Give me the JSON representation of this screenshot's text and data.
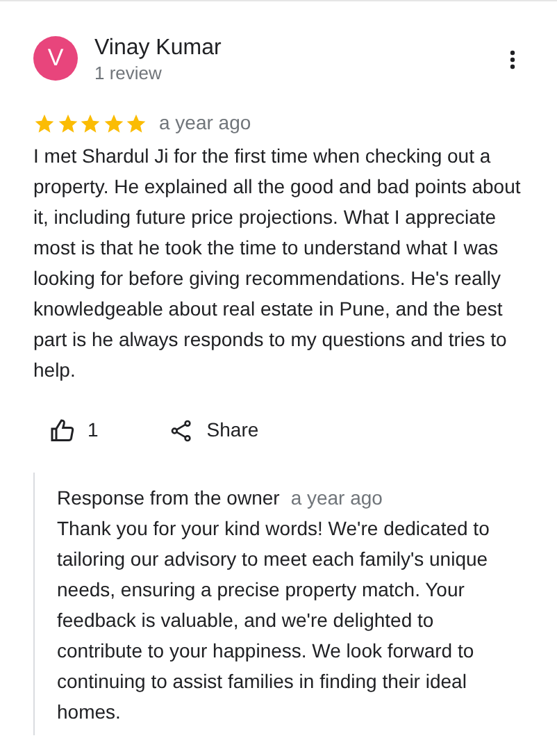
{
  "reviewer": {
    "initial": "V",
    "name": "Vinay Kumar",
    "review_count": "1 review"
  },
  "review": {
    "stars": 5,
    "time": "a year ago",
    "text": "I met Shardul Ji for the first time when checking out a property. He explained all the good and bad points about it, including future price projections. What I appreciate most is that he took the time to understand what I was looking for before giving recommendations. He's really knowledgeable about real estate in Pune, and the best part is he always responds to my questions and tries to help."
  },
  "actions": {
    "like_count": "1",
    "share_label": "Share"
  },
  "owner_response": {
    "title": "Response from the owner",
    "time": "a year ago",
    "text": "Thank you for your kind words! We're dedicated to tailoring our advisory to meet each family's unique needs, ensuring a precise property match. Your feedback is valuable, and we're delighted to contribute to your happiness. We look forward to continuing to assist families in finding their ideal homes."
  }
}
